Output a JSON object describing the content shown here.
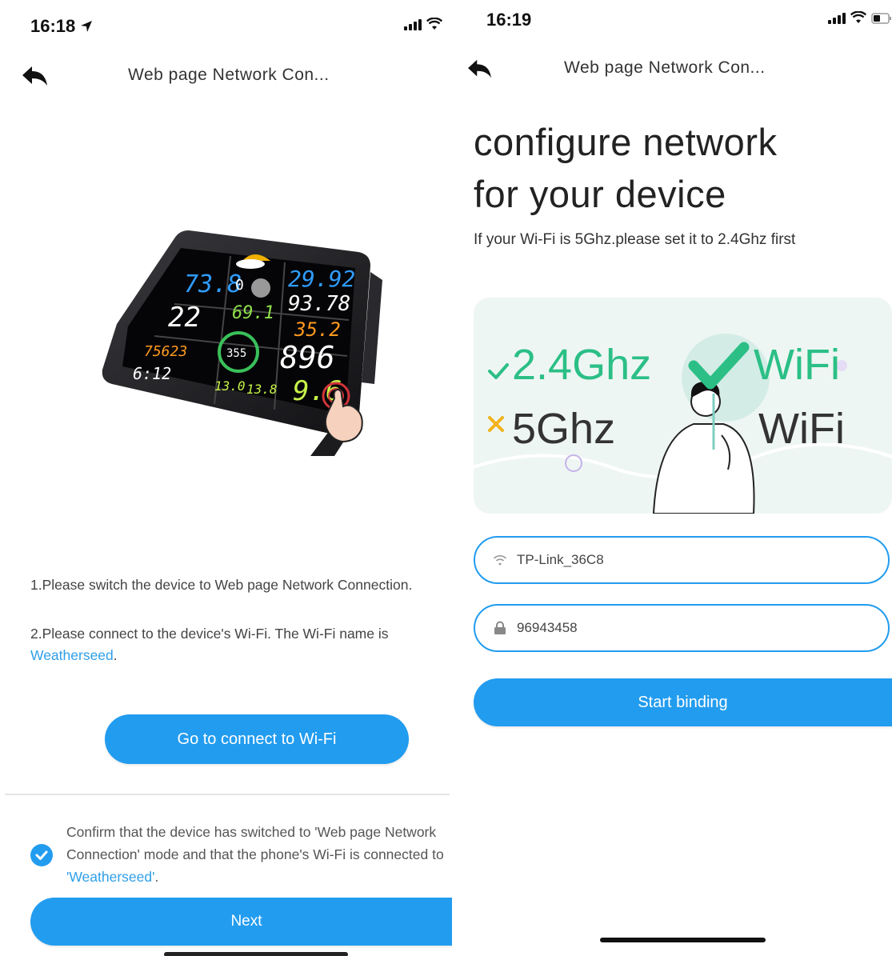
{
  "left_screen": {
    "status_time": "16:18",
    "nav_title": "Web page Network Con...",
    "instruction_1": "1.Please switch the device to Web page Network Connection.",
    "instruction_2_prefix": "2.Please connect to the device's Wi-Fi. The Wi-Fi name is ",
    "wifi_name": "Weatherseed",
    "instruction_2_suffix": ".",
    "connect_button": "Go to connect to Wi-Fi",
    "confirm_prefix": "Confirm that the device has switched to 'Web page Network Connection' mode and that the phone's Wi-Fi is connected to ",
    "confirm_wifi": "'Weatherseed'",
    "confirm_suffix": ".",
    "confirm_checked": true,
    "next_button": "Next",
    "display": {
      "outdoor_temp": "73.8",
      "indoor_temp": "22",
      "humidity": "69.1",
      "pressure_a": "29.92",
      "pressure_b": "93.78",
      "wind": "35.2",
      "rain": "896",
      "uv": "9.6",
      "date": "75623",
      "time": "6:12",
      "dir": "355",
      "min1": "13.0",
      "min2": "13.8",
      "moon": "0"
    }
  },
  "right_screen": {
    "status_time": "16:19",
    "nav_title": "Web page Network Con...",
    "title_line_1": "configure network",
    "title_line_2": "for your device",
    "hint": "If your Wi-Fi is 5Ghz.please set it to 2.4Ghz first",
    "banner": {
      "row1_band": "2.4Ghz",
      "row1_label": "WiFi",
      "row2_band": "5Ghz",
      "row2_label": "WiFi",
      "ok_color": "#2bbf86",
      "bad_color": "#f2b21b"
    },
    "ssid_value": "TP-Link_36C8",
    "password_value": "96943458",
    "start_button": "Start binding"
  },
  "colors": {
    "accent": "#229cef",
    "link": "#2f9fe8"
  }
}
